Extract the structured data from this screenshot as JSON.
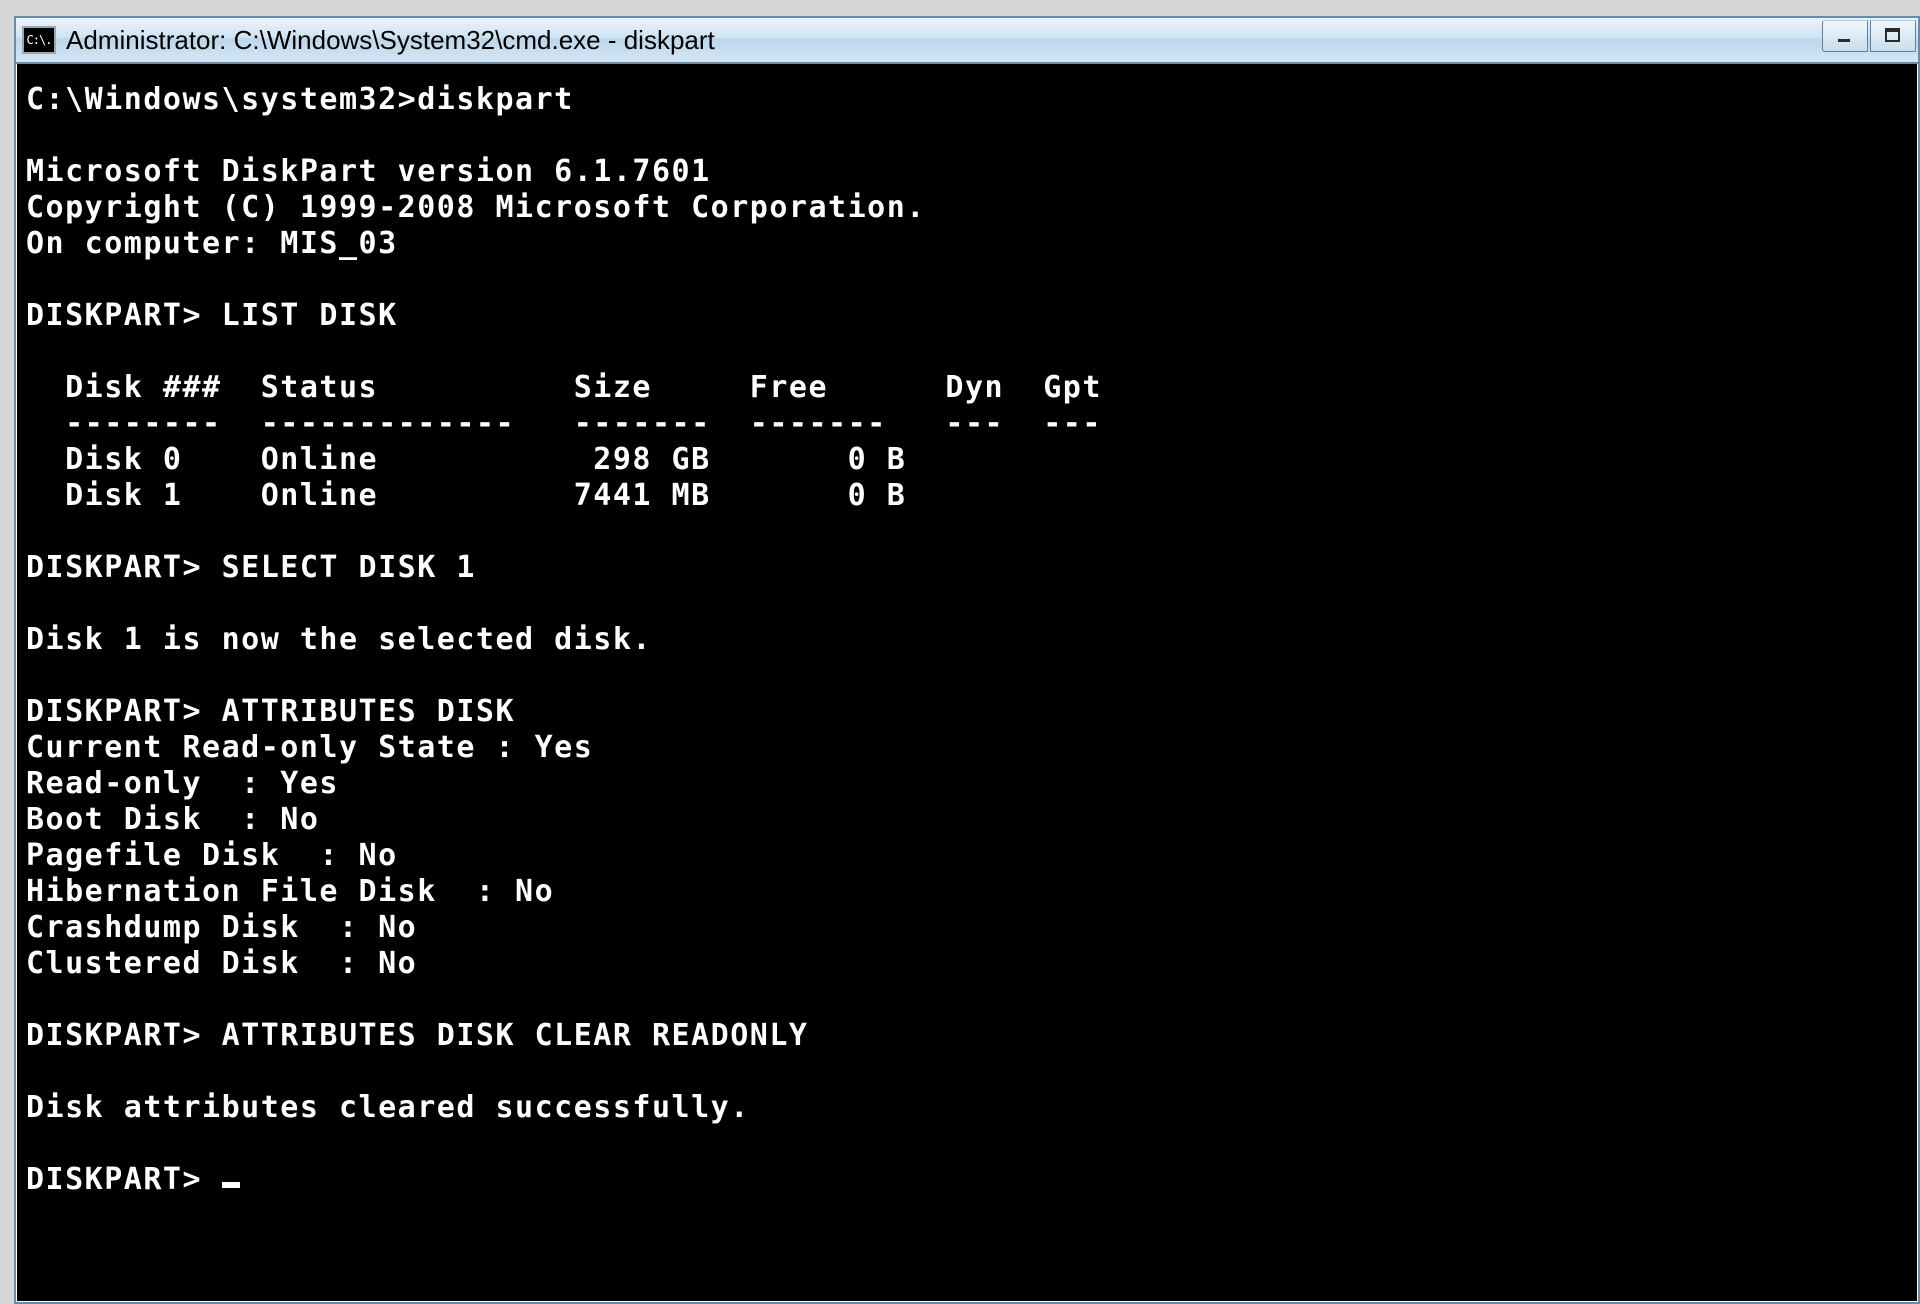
{
  "window": {
    "icon_label": "C:\\.",
    "title": "Administrator: C:\\Windows\\System32\\cmd.exe - diskpart"
  },
  "first_prompt": {
    "path": "C:\\Windows\\system32>",
    "command": "diskpart"
  },
  "banner": {
    "version": "Microsoft DiskPart version 6.1.7601",
    "copyright": "Copyright (C) 1999-2008 Microsoft Corporation.",
    "computer": "On computer: MIS_03"
  },
  "list_disk": {
    "prompt": "DISKPART>",
    "command": "LIST DISK",
    "headers": {
      "disk": "Disk ###",
      "status": "Status",
      "size": "Size",
      "free": "Free",
      "dyn": "Dyn",
      "gpt": "Gpt"
    },
    "rules": {
      "disk": "--------",
      "status": "-------------",
      "size": "-------",
      "free": "-------",
      "dyn": "---",
      "gpt": "---"
    },
    "rows": [
      {
        "disk": "Disk 0",
        "status": "Online",
        "size": "298 GB",
        "free": "0 B",
        "dyn": "",
        "gpt": ""
      },
      {
        "disk": "Disk 1",
        "status": "Online",
        "size": "7441 MB",
        "free": "0 B",
        "dyn": "",
        "gpt": ""
      }
    ]
  },
  "select": {
    "prompt": "DISKPART>",
    "command": "SELECT DISK 1",
    "result": "Disk 1 is now the selected disk."
  },
  "attributes": {
    "prompt": "DISKPART>",
    "command": "ATTRIBUTES DISK",
    "lines": [
      "Current Read-only State : Yes",
      "Read-only  : Yes",
      "Boot Disk  : No",
      "Pagefile Disk  : No",
      "Hibernation File Disk  : No",
      "Crashdump Disk  : No",
      "Clustered Disk  : No"
    ]
  },
  "clear": {
    "prompt": "DISKPART>",
    "command": "ATTRIBUTES DISK CLEAR READONLY",
    "result": "Disk attributes cleared successfully."
  },
  "final_prompt": "DISKPART> "
}
